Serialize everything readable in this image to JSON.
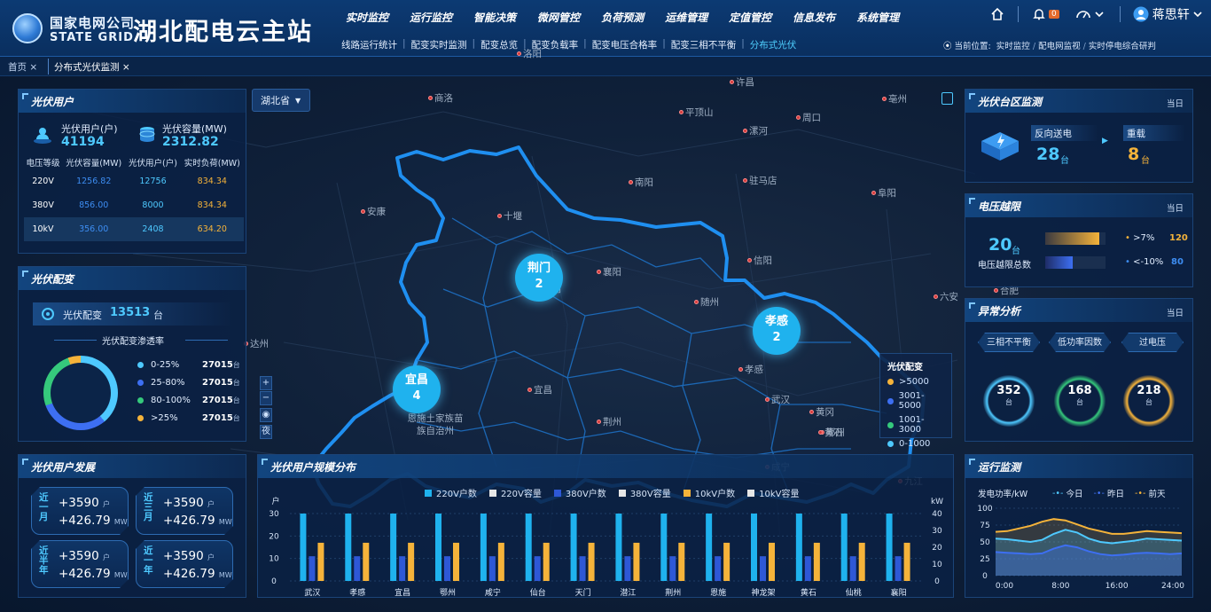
{
  "header": {
    "company_cn": "国家电网公司",
    "company_en": "STATE GRID",
    "app_title": "湖北配电云主站",
    "menu": [
      "实时监控",
      "运行监控",
      "智能决策",
      "微网管控",
      "负荷预测",
      "运维管理",
      "定值管控",
      "信息发布",
      "系统管理"
    ],
    "submenu": [
      "线路运行统计",
      "配变实时监测",
      "配变总览",
      "配变负载率",
      "配变电压合格率",
      "配变三相不平衡",
      "分布式光伏"
    ],
    "notif_count": "0",
    "username": "蒋思轩",
    "location_label": "当前位置:",
    "breadcrumb": [
      "实时监控",
      "配电网监视",
      "实时停电综合研判"
    ]
  },
  "tabs": {
    "home": "首页",
    "current": "分布式光伏监测"
  },
  "map": {
    "province_select": "湖北省",
    "cities": [
      "商洛",
      "洛阳",
      "平顶山",
      "许昌",
      "漯河",
      "周口",
      "亳州",
      "南阳",
      "驻马店",
      "阜阳",
      "安康",
      "十堰",
      "襄阳",
      "随州",
      "信阳",
      "荆门",
      "孝感",
      "宜昌",
      "武汉",
      "荆州",
      "黄冈",
      "鄂州",
      "咸宁",
      "黄石",
      "九江",
      "达州",
      "六安",
      "恩施土家族苗族自治州",
      "合肥"
    ],
    "bubbles": [
      {
        "name": "荆门",
        "value": "2"
      },
      {
        "name": "宜昌",
        "value": "4"
      },
      {
        "name": "孝感",
        "value": "2"
      }
    ],
    "zoom_in": "+",
    "zoom_out": "−",
    "view_eye": "◉",
    "view_night": "夜",
    "legend": {
      "title": "光伏配变",
      "items": [
        {
          "label": ">5000",
          "color": "#f5b33a"
        },
        {
          "label": "3001-5000",
          "color": "#3d6ff2"
        },
        {
          "label": "1001-3000",
          "color": "#35c97c"
        },
        {
          "label": "0-1000",
          "color": "#4ec9ff"
        }
      ]
    }
  },
  "pv_users": {
    "title": "光伏用户",
    "users_label": "光伏用户(户)",
    "users_value": "41194",
    "capacity_label": "光伏容量(MW)",
    "capacity_value": "2312.82",
    "columns": [
      "电压等级",
      "光伏容量(MW)",
      "光伏用户(户)",
      "实时负荷(MW)"
    ],
    "rows": [
      [
        "220V",
        "1256.82",
        "12756",
        "834.34"
      ],
      [
        "380V",
        "856.00",
        "8000",
        "834.34"
      ],
      [
        "10kV",
        "356.00",
        "2408",
        "634.20"
      ]
    ]
  },
  "pv_transformer": {
    "title": "光伏配变",
    "count_label": "光伏配变",
    "count_value": "13513",
    "count_unit": "台",
    "penetration_title": "光伏配变渗透率",
    "legend": [
      {
        "label": "0-25%",
        "value": "27015",
        "unit": "台",
        "color": "#4ec9ff"
      },
      {
        "label": "25-80%",
        "value": "27015",
        "unit": "台",
        "color": "#3d6ff2"
      },
      {
        "label": "80-100%",
        "value": "27015",
        "unit": "台",
        "color": "#35c97c"
      },
      {
        "label": ">25%",
        "value": "27015",
        "unit": "台",
        "color": "#f5b33a"
      }
    ]
  },
  "pv_development": {
    "title": "光伏用户发展",
    "cards": [
      {
        "period": "近一月",
        "users": "+3590",
        "users_unit": "户",
        "cap": "+426.79",
        "cap_unit": "MW"
      },
      {
        "period": "近三月",
        "users": "+3590",
        "users_unit": "户",
        "cap": "+426.79",
        "cap_unit": "MW"
      },
      {
        "period": "近半年",
        "users": "+3590",
        "users_unit": "户",
        "cap": "+426.79",
        "cap_unit": "MW"
      },
      {
        "period": "近一年",
        "users": "+3590",
        "users_unit": "户",
        "cap": "+426.79",
        "cap_unit": "MW"
      }
    ]
  },
  "scale_chart": {
    "title": "光伏用户规模分布",
    "left_unit": "户",
    "right_unit": "kW"
  },
  "chart_data": {
    "type": "bar",
    "categories": [
      "武汉",
      "孝感",
      "宜昌",
      "鄂州",
      "咸宁",
      "仙台",
      "天门",
      "潜江",
      "荆州",
      "恩施",
      "神龙架",
      "黄石",
      "仙桃",
      "襄阳"
    ],
    "series": [
      {
        "name": "220V户数",
        "color": "#1fb2ee",
        "axis": "left",
        "values": [
          30,
          30,
          30,
          30,
          30,
          30,
          30,
          30,
          30,
          30,
          30,
          30,
          30,
          30
        ]
      },
      {
        "name": "220V容量",
        "color": "#e6e6e6",
        "axis": "right",
        "values": [
          0,
          0,
          0,
          0,
          0,
          0,
          0,
          0,
          0,
          0,
          0,
          0,
          0,
          0
        ]
      },
      {
        "name": "380V户数",
        "color": "#2e58d6",
        "axis": "left",
        "values": [
          11,
          11,
          11,
          11,
          11,
          11,
          11,
          11,
          11,
          11,
          11,
          11,
          11,
          11
        ]
      },
      {
        "name": "380V容量",
        "color": "#e6e6e6",
        "axis": "right",
        "values": [
          0,
          0,
          0,
          0,
          0,
          0,
          0,
          0,
          0,
          0,
          0,
          0,
          0,
          0
        ]
      },
      {
        "name": "10kV户数",
        "color": "#f5b33a",
        "axis": "left",
        "values": [
          17,
          17,
          17,
          17,
          17,
          17,
          17,
          17,
          17,
          17,
          17,
          17,
          17,
          17
        ]
      },
      {
        "name": "10kV容量",
        "color": "#e6e6e6",
        "axis": "right",
        "values": [
          0,
          0,
          0,
          0,
          0,
          0,
          0,
          0,
          0,
          0,
          0,
          0,
          0,
          0
        ]
      }
    ],
    "ylim_left": [
      0,
      30
    ],
    "ylim_right": [
      0,
      40
    ],
    "yticks_left": [
      "30",
      "20",
      "10",
      "0"
    ],
    "yticks_right": [
      "40",
      "30",
      "20",
      "10",
      "0"
    ]
  },
  "pv_area": {
    "title": "光伏台区监测",
    "period": "当日",
    "reverse_label": "反向送电",
    "reverse_value": "28",
    "reverse_unit": "台",
    "overload_label": "重载",
    "overload_value": "8",
    "overload_unit": "台"
  },
  "voltage_limit": {
    "title": "电压越限",
    "period": "当日",
    "total_value": "20",
    "total_unit": "台",
    "total_label": "电压越限总数",
    "items": [
      {
        "label": ">7%",
        "value": "120",
        "color": "#f5b33a",
        "fraction": 0.9
      },
      {
        "label": "<-10%",
        "value": "80",
        "color": "#3d6ff2",
        "fraction": 0.45
      }
    ]
  },
  "anomaly": {
    "title": "异常分析",
    "period": "当日",
    "tabs": [
      "三相不平衡",
      "低功率因数",
      "过电压"
    ],
    "rings": [
      {
        "value": "352",
        "unit": "台",
        "color": "#4ec9ff"
      },
      {
        "value": "168",
        "unit": "台",
        "color": "#35c97c"
      },
      {
        "value": "218",
        "unit": "台",
        "color": "#f5b33a"
      }
    ]
  },
  "operation": {
    "title": "运行监测",
    "ylabel": "发电功率/kW",
    "legend": [
      {
        "name": "今日",
        "color": "#4ec9ff"
      },
      {
        "name": "昨日",
        "color": "#3d6ff2"
      },
      {
        "name": "前天",
        "color": "#f5b33a"
      }
    ],
    "yticks": [
      "100",
      "75",
      "50",
      "25",
      "0"
    ],
    "xticks": [
      "0:00",
      "8:00",
      "16:00",
      "24:00"
    ],
    "ylim": [
      0,
      100
    ],
    "series_today": [
      55,
      54,
      52,
      50,
      53,
      62,
      68,
      64,
      55,
      50,
      48,
      50,
      52,
      55,
      54,
      53,
      52
    ],
    "series_yesterday": [
      35,
      34,
      33,
      32,
      33,
      40,
      45,
      42,
      36,
      32,
      30,
      31,
      33,
      34,
      33,
      32,
      33
    ],
    "series_before": [
      65,
      66,
      70,
      74,
      80,
      84,
      82,
      76,
      70,
      66,
      62,
      62,
      64,
      66,
      65,
      64,
      63
    ]
  }
}
